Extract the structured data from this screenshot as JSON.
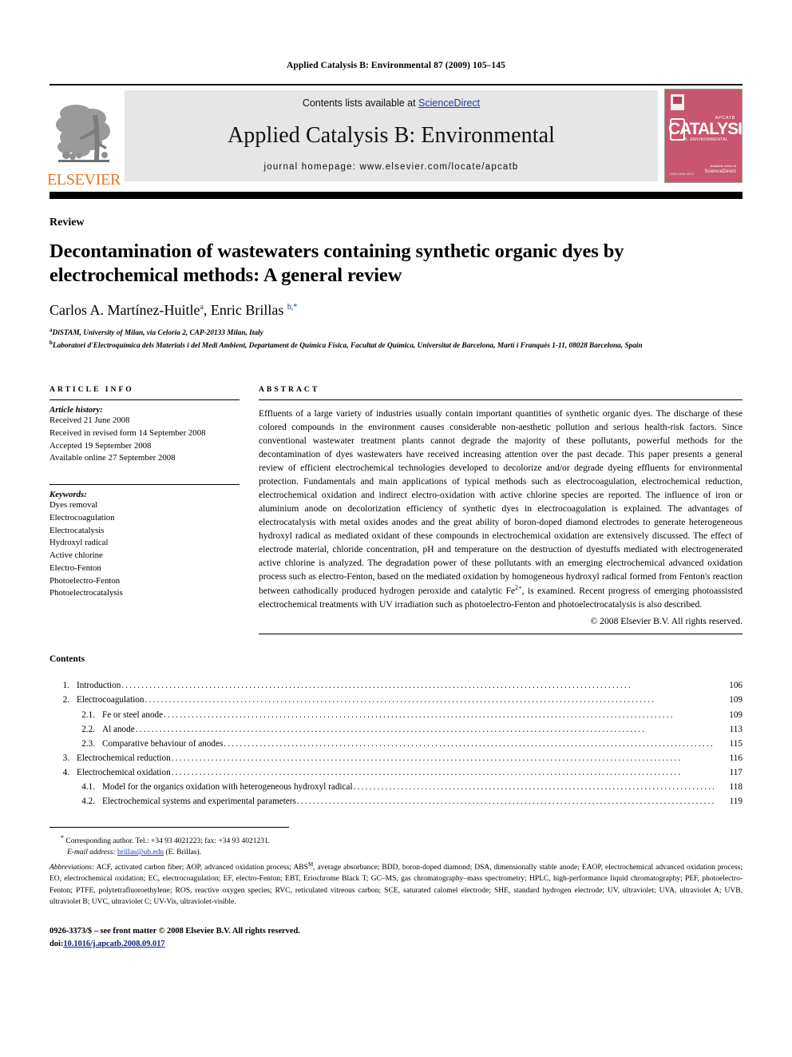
{
  "running_head": "Applied Catalysis B: Environmental 87 (2009) 105–145",
  "masthead": {
    "publisher_word": "ELSEVIER",
    "contents_prefix": "Contents lists available at ",
    "sciencedirect": "ScienceDirect",
    "journal_title": "Applied Catalysis B: Environmental",
    "homepage": "journal homepage: www.elsevier.com/locate/apcatb",
    "cover": {
      "top_right_label": "APCATB",
      "main_text": "CATALYSIS",
      "sub_text": "B: ENVIRONMENTAL",
      "footer_right": "Available online at",
      "footer_mark": "ScienceDirect",
      "footer_left": "ISSN 0926-3373",
      "bg_color": "#c8566e"
    }
  },
  "article": {
    "kind": "Review",
    "title": "Decontamination of wastewaters containing synthetic organic dyes by electrochemical methods: A general review",
    "authors_part1": "Carlos A. Martínez-Huitle",
    "authors_sup1": "a",
    "authors_part2": ", Enric Brillas ",
    "authors_sup2": "b,*",
    "affiliations": [
      {
        "sup": "a",
        "text": "DiSTAM, University of Milan, via Celoria 2, CAP-20133 Milan, Italy"
      },
      {
        "sup": "b",
        "text": "Laboratori d'Electroquímica dels Materials i del Medi Ambient, Departament de Química Física, Facultat de Química, Universitat de Barcelona, Martí i Franquès 1-11, 08028 Barcelona, Spain"
      }
    ]
  },
  "article_info": {
    "heading": "ARTICLE INFO",
    "history_label": "Article history:",
    "history": [
      "Received 21 June 2008",
      "Received in revised form 14 September 2008",
      "Accepted 19 September 2008",
      "Available online 27 September 2008"
    ],
    "keywords_label": "Keywords:",
    "keywords": [
      "Dyes removal",
      "Electrocoagulation",
      "Electrocatalysis",
      "Hydroxyl radical",
      "Active chlorine",
      "Electro-Fenton",
      "Photoelectro-Fenton",
      "Photoelectrocatalysis"
    ]
  },
  "abstract": {
    "heading": "ABSTRACT",
    "text_part1": "Effluents of a large variety of industries usually contain important quantities of synthetic organic dyes. The discharge of these colored compounds in the environment causes considerable non-aesthetic pollution and serious health-risk factors. Since conventional wastewater treatment plants cannot degrade the majority of these pollutants, powerful methods for the decontamination of dyes wastewaters have received increasing attention over the past decade. This paper presents a general review of efficient electrochemical technologies developed to decolorize and/or degrade dyeing effluents for environmental protection. Fundamentals and main applications of typical methods such as electrocoagulation, electrochemical reduction, electrochemical oxidation and indirect electro-oxidation with active chlorine species are reported. The influence of iron or aluminium anode on decolorization efficiency of synthetic dyes in electrocoagulation is explained. The advantages of electrocatalysis with metal oxides anodes and the great ability of boron-doped diamond electrodes to generate heterogeneous hydroxyl radical as mediated oxidant of these compounds in electrochemical oxidation are extensively discussed. The effect of electrode material, chloride concentration, pH and temperature on the destruction of dyestuffs mediated with electrogenerated active chlorine is analyzed. The degradation power of these pollutants with an emerging electrochemical advanced oxidation process such as electro-Fenton, based on the mediated oxidation by homogeneous hydroxyl radical formed from Fenton's reaction between cathodically produced hydrogen peroxide and catalytic Fe",
    "superscript": "2+",
    "text_part2": ", is examined. Recent progress of emerging photoassisted electrochemical treatments with UV irradiation such as photoelectro-Fenton and photoelectrocatalysis is also described.",
    "copyright": "© 2008 Elsevier B.V. All rights reserved."
  },
  "contents": {
    "heading": "Contents",
    "entries": [
      {
        "num": "1.",
        "level": 1,
        "label": "Introduction",
        "page": "106"
      },
      {
        "num": "2.",
        "level": 1,
        "label": "Electrocoagulation",
        "page": "109"
      },
      {
        "num": "2.1.",
        "level": 2,
        "label": "Fe or steel anode",
        "page": "109"
      },
      {
        "num": "2.2.",
        "level": 2,
        "label": "Al anode",
        "page": "113"
      },
      {
        "num": "2.3.",
        "level": 2,
        "label": "Comparative behaviour of anodes",
        "page": "115"
      },
      {
        "num": "3.",
        "level": 1,
        "label": "Electrochemical reduction",
        "page": "116"
      },
      {
        "num": "4.",
        "level": 1,
        "label": "Electrochemical oxidation",
        "page": "117"
      },
      {
        "num": "4.1.",
        "level": 2,
        "label": "Model for the organics oxidation with heterogeneous hydroxyl radical",
        "page": "118"
      },
      {
        "num": "4.2.",
        "level": 2,
        "label": "Electrochemical systems and experimental parameters",
        "page": "119"
      }
    ]
  },
  "footnotes": {
    "corresponding": "Corresponding author. Tel.: +34 93 4021223; fax: +34 93 4021231.",
    "email_label": "E-mail address:",
    "email": "brillas@ub.edu",
    "email_suffix": "(E. Brillas).",
    "abbrev_label": "Abbreviations:",
    "abbrev_part1": " ACF, activated carbon fiber; AOP, advanced oxidation process; ABS",
    "abbrev_sup": "M",
    "abbrev_part2": ", average absorbance; BDD, boron-doped diamond; DSA, dimensionally stable anode; EAOP, electrochemical advanced oxidation process; EO, electrochemical oxidation; EC, electrocoagulation; EF, electro-Fenton; EBT, Eriochrome Black T; GC–MS, gas chromatography–mass spectrometry; HPLC, high-performance liquid chromatography; PEF, photoelectro-Fenton; PTFE, polytetrafluoroethylene; ROS, reactive oxygen species; RVC, reticulated vitreous carbon; SCE, saturated calomel electrode; SHE, standard hydrogen electrode; UV, ultraviolet; UVA, ultraviolet A; UVB, ultraviolet B; UVC, ultraviolet C; UV-Vis, ultraviolet-visible."
  },
  "footer": {
    "issn_line": "0926-3373/$ – see front matter © 2008 Elsevier B.V. All rights reserved.",
    "doi_label": "doi:",
    "doi_value": "10.1016/j.apcatb.2008.09.017"
  }
}
